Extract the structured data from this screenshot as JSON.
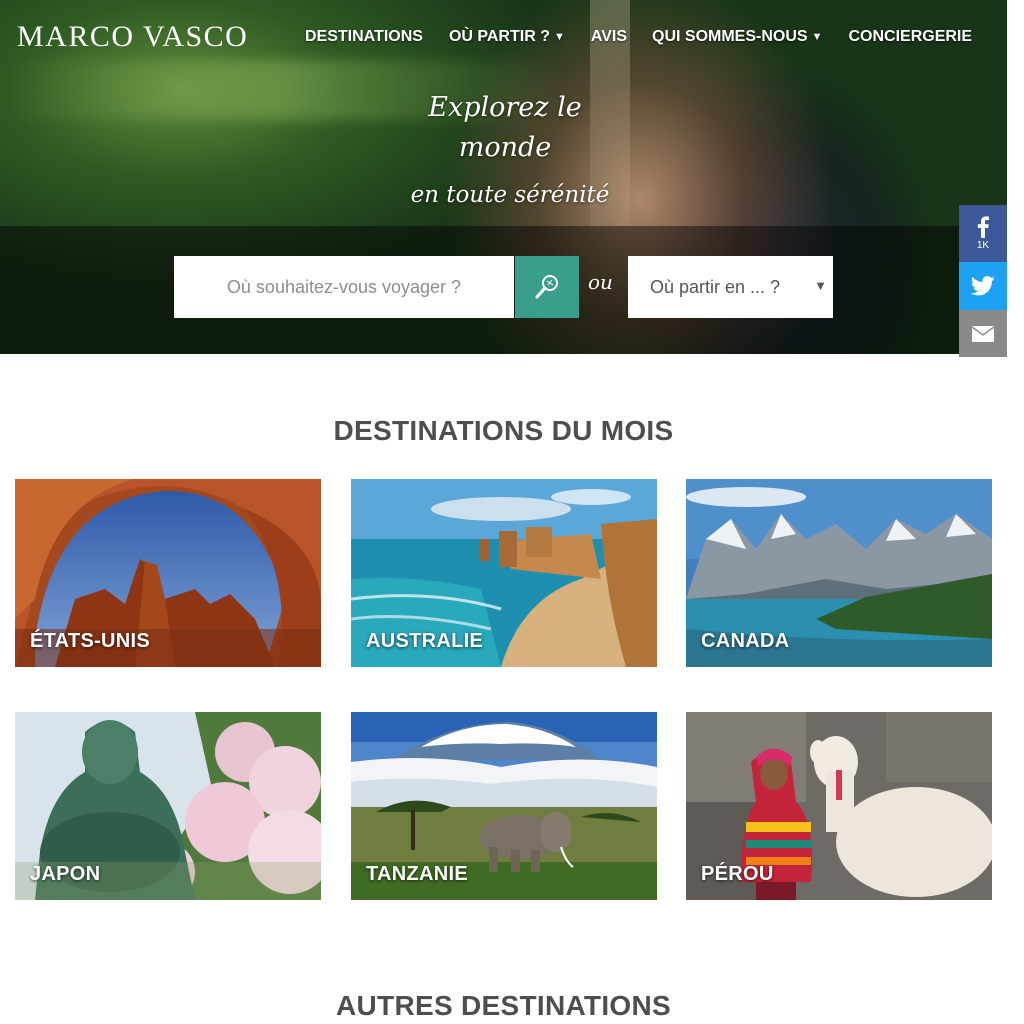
{
  "brand": {
    "logo": "MARCO VASCO"
  },
  "nav": {
    "items": [
      {
        "label": "DESTINATIONS",
        "dropdown": false
      },
      {
        "label": "OÙ PARTIR ?",
        "dropdown": true
      },
      {
        "label": "AVIS",
        "dropdown": false
      },
      {
        "label": "QUI SOMMES-NOUS",
        "dropdown": true
      },
      {
        "label": "CONCIERGERIE",
        "dropdown": false
      }
    ],
    "caret": "▼"
  },
  "hero": {
    "tagline_line1": "Explorez le monde",
    "tagline_line2": "en toute sérénité",
    "search_placeholder": "Où souhaitez-vous voyager ?",
    "search_button_icon": "magnifier-icon",
    "or_label": "ou",
    "when_select": "Où partir en ... ?",
    "when_arrow": "▼"
  },
  "social": {
    "facebook_icon": "facebook-icon",
    "facebook_count": "1K",
    "twitter_icon": "twitter-icon",
    "email_icon": "email-icon"
  },
  "destinations_month": {
    "title": "DESTINATIONS DU MOIS",
    "cards": [
      {
        "label": "ÉTATS-UNIS"
      },
      {
        "label": "AUSTRALIE"
      },
      {
        "label": "CANADA"
      },
      {
        "label": "JAPON"
      },
      {
        "label": "TANZANIE"
      },
      {
        "label": "PÉROU"
      }
    ]
  },
  "other_destinations": {
    "title": "AUTRES DESTINATIONS"
  },
  "colors": {
    "accent_teal": "#3a9e8c",
    "facebook": "#3b5998",
    "twitter": "#1da1f2",
    "email": "#8a8a8a",
    "heading": "#4e4e4e"
  }
}
